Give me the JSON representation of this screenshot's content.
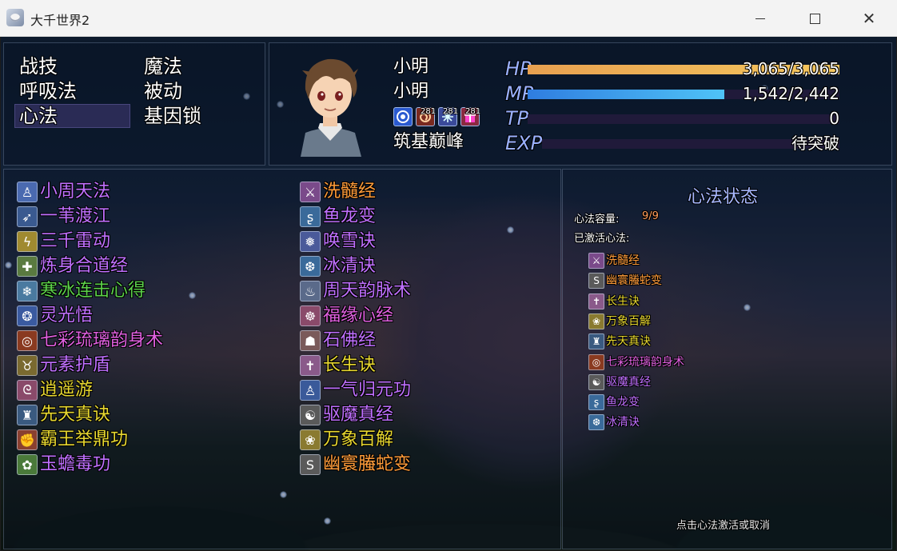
{
  "window": {
    "title": "大千世界2",
    "minimize_icon": "minimize-icon",
    "maximize_icon": "maximize-icon",
    "close_icon": "close-icon",
    "close_glyph": "✕"
  },
  "command_menu": {
    "items": [
      {
        "label": "战技"
      },
      {
        "label": "魔法"
      },
      {
        "label": "呼吸法"
      },
      {
        "label": "被动"
      },
      {
        "label": "心法",
        "selected": true
      },
      {
        "label": "基因锁"
      }
    ]
  },
  "actor": {
    "name": "小明",
    "nickname": "小明",
    "class": "筑基巅峰",
    "states": [
      {
        "icon": "spirit-icon",
        "turns": ""
      },
      {
        "icon": "swirl-icon",
        "turns": "281"
      },
      {
        "icon": "snowflake-icon",
        "turns": "281"
      },
      {
        "icon": "gift-icon",
        "turns": "281"
      }
    ],
    "gauges": [
      {
        "label": "HP",
        "value": "3,065/3,065",
        "ratio": 1.0,
        "color_from": "#e8a050",
        "color_to": "#f4c75e"
      },
      {
        "label": "MP",
        "value": "1,542/2,442",
        "ratio": 0.63,
        "color_from": "#2f7de0",
        "color_to": "#4fc3f7"
      },
      {
        "label": "TP",
        "value": "0",
        "ratio": 0.0,
        "color_from": "#3aa85a",
        "color_to": "#8ce07a"
      },
      {
        "label": "EXP",
        "value": "待突破",
        "ratio": 0.0,
        "color_from": "#c06060",
        "color_to": "#e08080"
      }
    ]
  },
  "skills_left": [
    {
      "name": "小周天法",
      "color": "#c070ff",
      "icon": "meditation-icon",
      "icon_bg": "#4a6ab0",
      "glyph": "♙"
    },
    {
      "name": "一苇渡江",
      "color": "#c070ff",
      "icon": "sprint-icon",
      "icon_bg": "#3a5a90",
      "glyph": "➶"
    },
    {
      "name": "三千雷动",
      "color": "#c070ff",
      "icon": "lightning-icon",
      "icon_bg": "#a08a30",
      "glyph": "ϟ"
    },
    {
      "name": "炼身合道经",
      "color": "#c070ff",
      "icon": "body-icon",
      "icon_bg": "#5a7a40",
      "glyph": "✚"
    },
    {
      "name": "寒冰连击心得",
      "color": "#5cd14a",
      "icon": "frost-icon",
      "icon_bg": "#4a7aa0",
      "glyph": "❄"
    },
    {
      "name": "灵光悟",
      "color": "#c070ff",
      "icon": "spirit-icon",
      "icon_bg": "#3a5aa0",
      "glyph": "❂"
    },
    {
      "name": "七彩琉璃韵身术",
      "color": "#e060e0",
      "icon": "swirl-icon",
      "icon_bg": "#8a3a20",
      "glyph": "◎"
    },
    {
      "name": "元素护盾",
      "color": "#c070ff",
      "icon": "horns-icon",
      "icon_bg": "#7a6a30",
      "glyph": "♉"
    },
    {
      "name": "逍遥游",
      "color": "#e8d830",
      "icon": "wind-icon",
      "icon_bg": "#8a4a6a",
      "glyph": "ᘓ"
    },
    {
      "name": "先天真诀",
      "color": "#e8d830",
      "icon": "guardian-icon",
      "icon_bg": "#3a5a80",
      "glyph": "♜"
    },
    {
      "name": "霸王举鼎功",
      "color": "#e8d830",
      "icon": "strength-icon",
      "icon_bg": "#8a4030",
      "glyph": "✊"
    },
    {
      "name": "玉蟾毒功",
      "color": "#c070ff",
      "icon": "toad-icon",
      "icon_bg": "#4a7a3a",
      "glyph": "✿"
    }
  ],
  "skills_right": [
    {
      "name": "洗髓经",
      "color": "#ff9c3a",
      "icon": "blade-icon",
      "icon_bg": "#7a4a8a",
      "glyph": "⚔"
    },
    {
      "name": "鱼龙变",
      "color": "#c070ff",
      "icon": "dragon-icon",
      "icon_bg": "#3a6a9a",
      "glyph": "ʂ"
    },
    {
      "name": "唤雪诀",
      "color": "#c070ff",
      "icon": "snowflake-icon",
      "icon_bg": "#4a5a9a",
      "glyph": "❅"
    },
    {
      "name": "冰清诀",
      "color": "#c070ff",
      "icon": "ice-icon",
      "icon_bg": "#3a6a9a",
      "glyph": "❆"
    },
    {
      "name": "周天韵脉术",
      "color": "#c070ff",
      "icon": "vein-icon",
      "icon_bg": "#5a6a8a",
      "glyph": "♨"
    },
    {
      "name": "福缘心经",
      "color": "#e060e0",
      "icon": "fortune-icon",
      "icon_bg": "#8a4a6a",
      "glyph": "☸"
    },
    {
      "name": "石佛经",
      "color": "#c070ff",
      "icon": "buddha-icon",
      "icon_bg": "#7a5a5a",
      "glyph": "☗"
    },
    {
      "name": "长生诀",
      "color": "#e8d830",
      "icon": "longevity-icon",
      "icon_bg": "#8a5a8a",
      "glyph": "✝"
    },
    {
      "name": "一气归元功",
      "color": "#c070ff",
      "icon": "origin-icon",
      "icon_bg": "#3a5a9a",
      "glyph": "♙"
    },
    {
      "name": "驱魔真经",
      "color": "#c070ff",
      "icon": "exorcism-icon",
      "icon_bg": "#5a5a5a",
      "glyph": "☯"
    },
    {
      "name": "万象百解",
      "color": "#e8d830",
      "icon": "myriad-icon",
      "icon_bg": "#8a7a30",
      "glyph": "❀"
    },
    {
      "name": "幽寰螣蛇变",
      "color": "#ff9c3a",
      "icon": "serpent-icon",
      "icon_bg": "#5a5a5a",
      "glyph": "S"
    }
  ],
  "state_panel": {
    "title": "心法状态",
    "capacity_label": "心法容量:",
    "capacity_value": "9/9",
    "active_label": "已激活心法:",
    "active": [
      {
        "name": "洗髓经",
        "color": "#ff9c3a",
        "icon": "blade-icon",
        "icon_bg": "#7a4a8a",
        "glyph": "⚔"
      },
      {
        "name": "幽寰螣蛇变",
        "color": "#ff9c3a",
        "icon": "serpent-icon",
        "icon_bg": "#5a5a5a",
        "glyph": "S"
      },
      {
        "name": "长生诀",
        "color": "#e8d830",
        "icon": "longevity-icon",
        "icon_bg": "#8a5a8a",
        "glyph": "✝"
      },
      {
        "name": "万象百解",
        "color": "#e8d830",
        "icon": "myriad-icon",
        "icon_bg": "#8a7a30",
        "glyph": "❀"
      },
      {
        "name": "先天真诀",
        "color": "#e8d830",
        "icon": "guardian-icon",
        "icon_bg": "#3a5a80",
        "glyph": "♜"
      },
      {
        "name": "七彩琉璃韵身术",
        "color": "#e060e0",
        "icon": "swirl-icon",
        "icon_bg": "#8a3a20",
        "glyph": "◎"
      },
      {
        "name": "驱魔真经",
        "color": "#c070ff",
        "icon": "exorcism-icon",
        "icon_bg": "#5a5a5a",
        "glyph": "☯"
      },
      {
        "name": "鱼龙变",
        "color": "#c070ff",
        "icon": "dragon-icon",
        "icon_bg": "#3a6a9a",
        "glyph": "ʂ"
      },
      {
        "name": "冰清诀",
        "color": "#c070ff",
        "icon": "ice-icon",
        "icon_bg": "#3a6a9a",
        "glyph": "❆"
      }
    ],
    "hint": "点击心法激活或取消"
  }
}
